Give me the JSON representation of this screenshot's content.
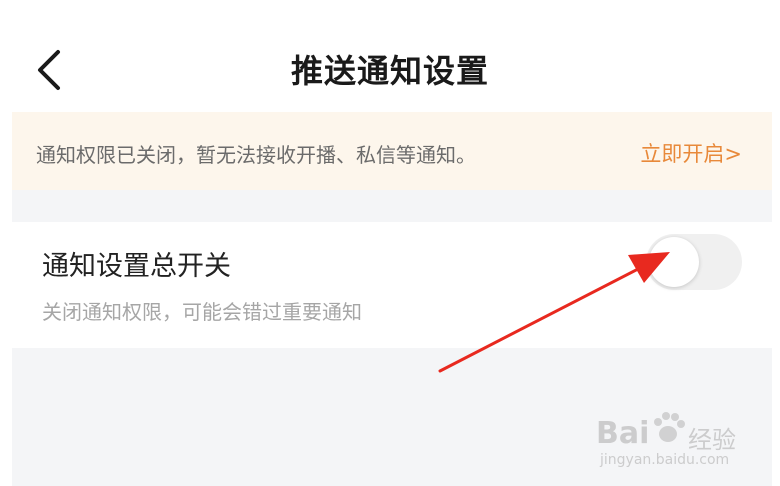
{
  "header": {
    "title": "推送通知设置",
    "back_icon": "chevron-left-icon"
  },
  "banner": {
    "message": "通知权限已关闭，暂无法接收开播、私信等通知。",
    "action_label": "立即开启>",
    "action_color": "#e8893a",
    "background": "#fdf6ec"
  },
  "settings": {
    "master_switch": {
      "title": "通知设置总开关",
      "description": "关闭通知权限，可能会错过重要通知",
      "enabled": false
    }
  },
  "annotation": {
    "arrow_color": "#e8291f",
    "arrow_icon": "red-arrow-icon"
  },
  "watermark": {
    "brand": "Bai",
    "brand_suffix": "经验",
    "url": "jingyan.baidu.com",
    "logo_icon": "paw-icon"
  }
}
